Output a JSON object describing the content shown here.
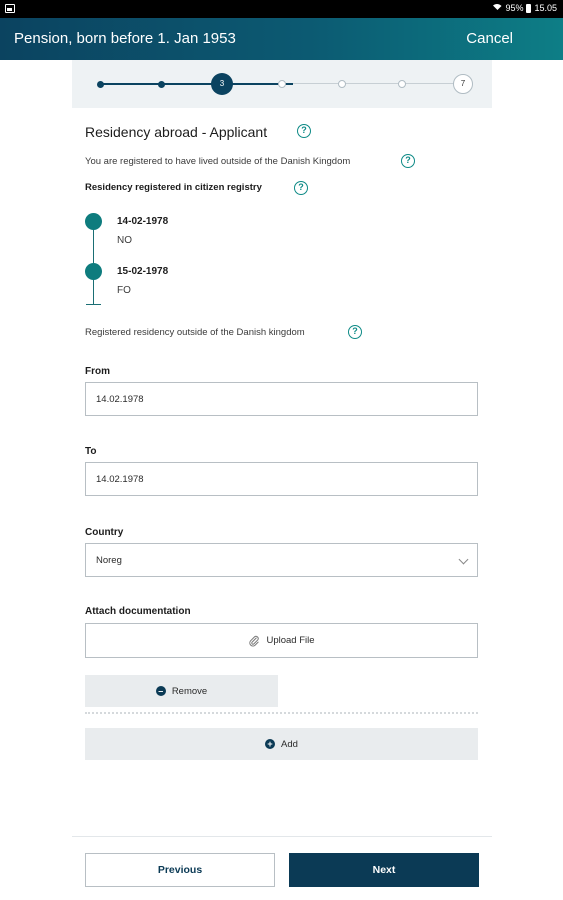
{
  "status_bar": {
    "battery": "95%",
    "time": "15.05"
  },
  "app_bar": {
    "title": "Pension, born before 1. Jan 1953",
    "cancel_label": "Cancel",
    "background_colors": [
      "#0b4360",
      "#0d7e86"
    ]
  },
  "stepper": {
    "total_steps": 7,
    "current_step": 3,
    "current_label": "3",
    "last_label": "7"
  },
  "page": {
    "heading": "Residency abroad - Applicant",
    "registered_text": "You are registered to have lived outside of the Danish Kingdom",
    "registry_label": "Residency registered in citizen registry",
    "timeline": [
      {
        "date": "14-02-1978",
        "country": "NO"
      },
      {
        "date": "15-02-1978",
        "country": "FO"
      }
    ],
    "outside_label": "Registered residency outside of the Danish kingdom"
  },
  "form": {
    "from_label": "From",
    "from_value": "14.02.1978",
    "to_label": "To",
    "to_value": "14.02.1978",
    "country_label": "Country",
    "country_value": "Noreg",
    "attach_label": "Attach documentation",
    "upload_label": "Upload File",
    "remove_label": "Remove",
    "add_label": "Add"
  },
  "footer": {
    "previous_label": "Previous",
    "next_label": "Next"
  },
  "icons": {
    "help": "question-circle",
    "upload": "paperclip",
    "remove": "minus-circle",
    "add": "plus-circle",
    "chevron": "chevron-down"
  },
  "colors": {
    "primary": "#0b3a55",
    "accent_teal": "#0e7c7e"
  }
}
